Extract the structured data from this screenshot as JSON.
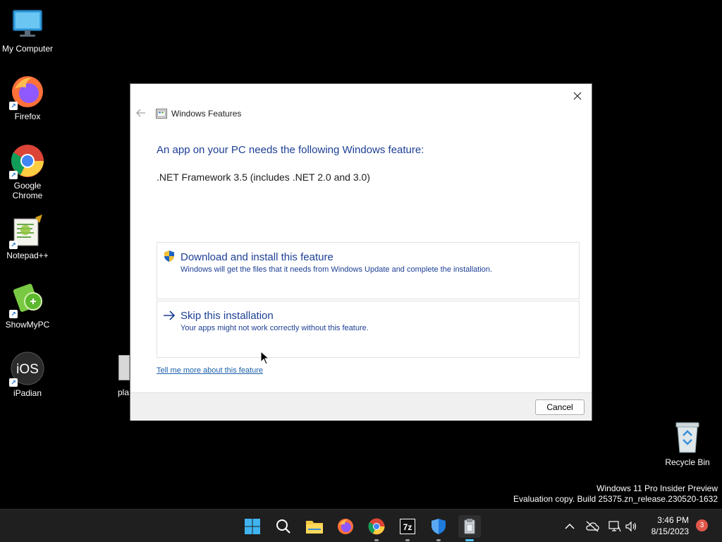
{
  "desktop": {
    "icons": [
      {
        "label": "My Computer",
        "icon": "monitor-icon"
      },
      {
        "label": "Firefox",
        "icon": "firefox-icon"
      },
      {
        "label": "Google Chrome",
        "icon": "chrome-icon"
      },
      {
        "label": "Notepad++",
        "icon": "notepadpp-icon"
      },
      {
        "label": "ShowMyPC",
        "icon": "showmypc-icon"
      },
      {
        "label": "iPadian",
        "icon": "ipadian-icon"
      }
    ],
    "partial_label": "pla",
    "recycle_bin": {
      "label": "Recycle Bin",
      "icon": "recycle-bin-icon"
    }
  },
  "dialog": {
    "title": "Windows Features",
    "heading": "An app on your PC needs the following Windows feature:",
    "feature_name": ".NET Framework 3.5 (includes .NET 2.0 and 3.0)",
    "options": [
      {
        "title": "Download and install this feature",
        "description": "Windows will get the files that it needs from Windows Update and complete the installation.",
        "icon": "uac-shield-icon"
      },
      {
        "title": "Skip this installation",
        "description": "Your apps might not work correctly without this feature.",
        "icon": "arrow-right-icon"
      }
    ],
    "more_link": "Tell me more about this feature",
    "cancel_label": "Cancel"
  },
  "watermark": {
    "line1": "Windows 11 Pro Insider Preview",
    "line2": "Evaluation copy. Build 25375.zn_release.230520-1632"
  },
  "taskbar": {
    "apps": [
      "start-icon",
      "search-icon",
      "file-explorer-icon",
      "firefox-icon",
      "chrome-icon",
      "7zip-icon",
      "windows-security-icon",
      "installer-icon"
    ],
    "clock_time": "3:46 PM",
    "clock_date": "8/15/2023",
    "notification_count": "3",
    "sevenzip_label": "7z"
  },
  "colors": {
    "accent": "#1c3f94",
    "link": "#1b5fa8",
    "taskbar": "#1f1f1f",
    "active_indicator": "#4cc2ff"
  }
}
